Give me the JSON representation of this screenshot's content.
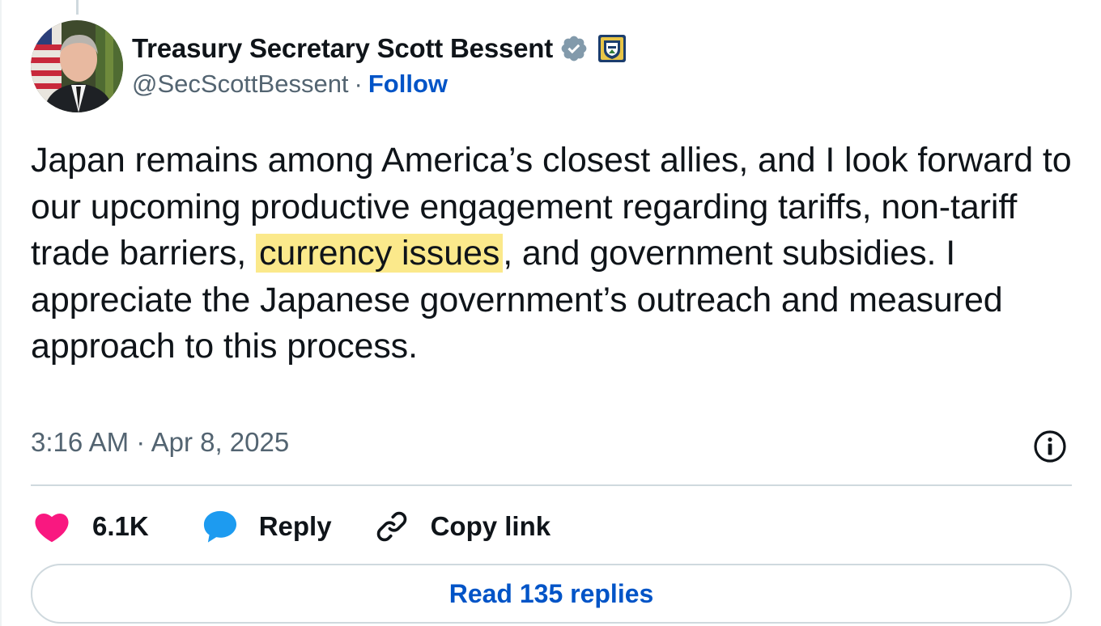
{
  "author": {
    "display_name": "Treasury Secretary Scott Bessent",
    "handle": "@SecScottBessent",
    "separator": "·",
    "follow_label": "Follow",
    "avatar_icon": "person-avatar",
    "verified_icon": "verified-badge-icon",
    "affiliate_icon": "treasury-seal-icon"
  },
  "tweet": {
    "text_before": "Japan remains among America’s closest allies, and I look forward to our upcoming productive engagement regarding tariffs, non-tariff trade barriers, ",
    "highlight": "currency issues",
    "text_after": ", and government subsidies. I appreciate the Japanese government’s outreach and measured approach to this process.",
    "timestamp": "3:16 AM · Apr 8, 2025"
  },
  "actions": {
    "like_count": "6.1K",
    "reply_label": "Reply",
    "copy_link_label": "Copy link"
  },
  "read_replies_label": "Read 135 replies",
  "colors": {
    "link_blue": "#0054c7",
    "like_red": "#f91880",
    "reply_blue": "#1d9bf0",
    "highlight_yellow": "#fbe98b",
    "secondary_text": "#536471"
  }
}
